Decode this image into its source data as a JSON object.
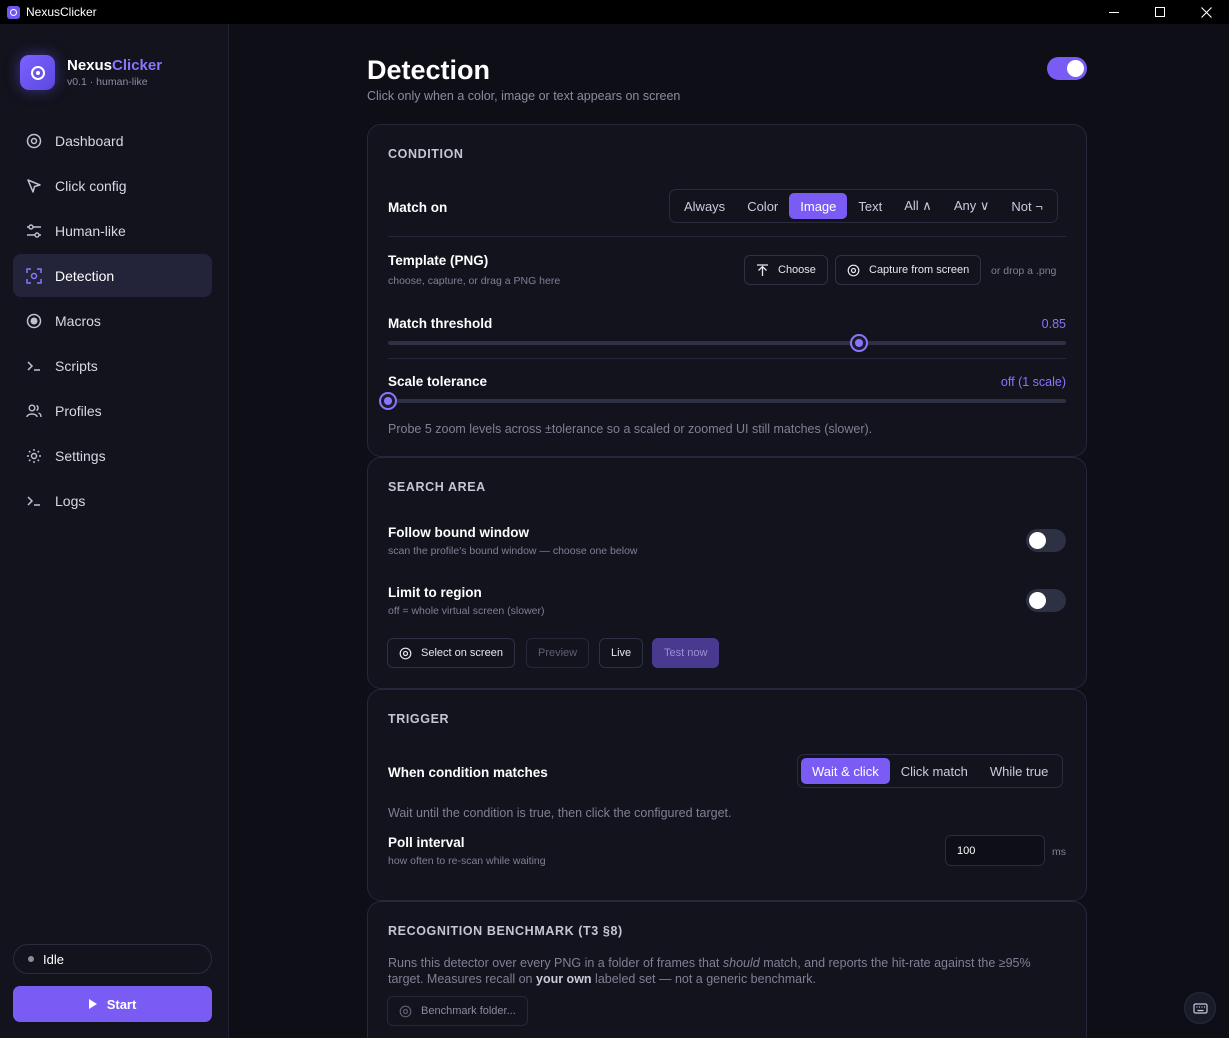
{
  "window": {
    "title": "NexusClicker"
  },
  "brand": {
    "name_main": "Nexus",
    "name_accent": "Clicker",
    "version": "v0.1 · human-like"
  },
  "sidebar": {
    "items": [
      {
        "label": "Dashboard",
        "icon": "target-icon"
      },
      {
        "label": "Click config",
        "icon": "cursor-icon"
      },
      {
        "label": "Human-like",
        "icon": "sliders-icon"
      },
      {
        "label": "Detection",
        "icon": "scan-icon",
        "active": true
      },
      {
        "label": "Macros",
        "icon": "record-icon"
      },
      {
        "label": "Scripts",
        "icon": "terminal-icon"
      },
      {
        "label": "Profiles",
        "icon": "users-icon"
      },
      {
        "label": "Settings",
        "icon": "gear-icon"
      },
      {
        "label": "Logs",
        "icon": "terminal-icon"
      }
    ],
    "status": "Idle",
    "start_label": "Start"
  },
  "page": {
    "title": "Detection",
    "subtitle": "Click only when a color, image or text appears on screen",
    "enabled": true
  },
  "condition": {
    "heading": "CONDITION",
    "match_on_label": "Match on",
    "match_options": [
      "Always",
      "Color",
      "Image",
      "Text",
      "All ∧",
      "Any ∨",
      "Not ¬"
    ],
    "match_selected": "Image",
    "template_label": "Template (PNG)",
    "template_sub": "choose, capture, or drag a PNG here",
    "choose_label": "Choose",
    "capture_label": "Capture from screen",
    "drop_hint": "or drop a .png",
    "threshold_label": "Match threshold",
    "threshold_value": "0.85",
    "threshold_fraction": 0.695,
    "scale_label": "Scale tolerance",
    "scale_value": "off (1 scale)",
    "scale_fraction": 0.0,
    "scale_desc": "Probe 5 zoom levels across ±tolerance so a scaled or zoomed UI still matches (slower)."
  },
  "search_area": {
    "heading": "SEARCH AREA",
    "follow_label": "Follow bound window",
    "follow_sub": "scan the profile's bound window — choose one below",
    "follow_on": false,
    "limit_label": "Limit to region",
    "limit_sub": "off = whole virtual screen (slower)",
    "limit_on": false,
    "select_label": "Select on screen",
    "preview_label": "Preview",
    "live_label": "Live",
    "test_label": "Test now"
  },
  "trigger": {
    "heading": "TRIGGER",
    "when_label": "When condition matches",
    "options": [
      "Wait & click",
      "Click match",
      "While true"
    ],
    "selected": "Wait & click",
    "desc": "Wait until the condition is true, then click the configured target.",
    "poll_label": "Poll interval",
    "poll_sub": "how often to re-scan while waiting",
    "poll_value": "100",
    "poll_unit": "ms"
  },
  "benchmark": {
    "heading": "RECOGNITION BENCHMARK (T3 §8)",
    "desc_1": "Runs this detector over every PNG in a folder of frames that ",
    "desc_em": "should",
    "desc_2": " match, and reports the hit-rate against the ≥95%",
    "desc_3": "target. Measures recall on ",
    "desc_bold": "your own",
    "desc_4": " labeled set — not a generic benchmark.",
    "button_label": "Benchmark folder..."
  },
  "colors": {
    "accent": "#7a5cf5",
    "accent_text": "#8b74ff",
    "bg": "#0d0e16",
    "panel": "#12131d"
  }
}
